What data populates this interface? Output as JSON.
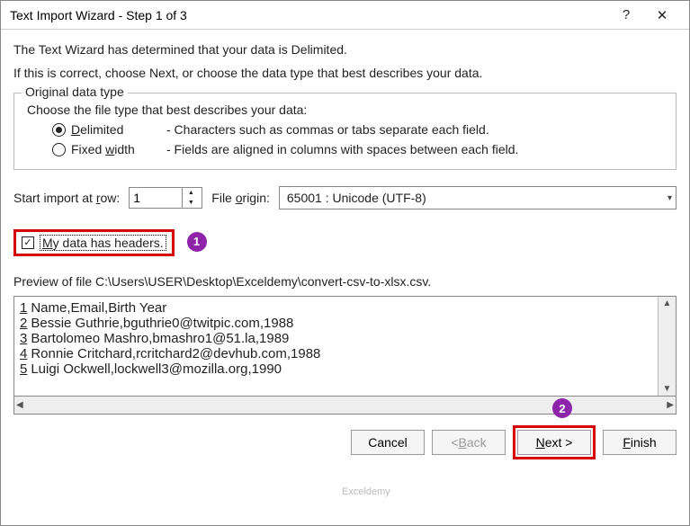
{
  "title": "Text Import Wizard - Step 1 of 3",
  "intro_line1": "The Text Wizard has determined that your data is Delimited.",
  "intro_line2": "If this is correct, choose Next, or choose the data type that best describes your data.",
  "group": {
    "legend": "Original data type",
    "desc": "Choose the file type that best describes your data:",
    "delimited_label": "Delimited",
    "delimited_desc": "- Characters such as commas or tabs separate each field.",
    "fixed_label": "Fixed width",
    "fixed_desc": "- Fields are aligned in columns with spaces between each field."
  },
  "start_row_label": "Start import at row:",
  "start_row_value": "1",
  "file_origin_label": "File origin:",
  "file_origin_value": "65001 : Unicode (UTF-8)",
  "headers_label": "My data has headers.",
  "preview_label": "Preview of file C:\\Users\\USER\\Desktop\\Exceldemy\\convert-csv-to-xlsx.csv.",
  "preview_rows": [
    {
      "n": "1",
      "text": "Name,Email,Birth Year"
    },
    {
      "n": "2",
      "text": "Bessie Guthrie,bguthrie0@twitpic.com,1988"
    },
    {
      "n": "3",
      "text": "Bartolomeo Mashro,bmashro1@51.la,1989"
    },
    {
      "n": "4",
      "text": "Ronnie Critchard,rcritchard2@devhub.com,1988"
    },
    {
      "n": "5",
      "text": "Luigi Ockwell,lockwell3@mozilla.org,1990"
    }
  ],
  "buttons": {
    "cancel": "Cancel",
    "back": "< Back",
    "next": "Next >",
    "finish": "Finish"
  },
  "watermark": "Exceldemy",
  "callouts": {
    "one": "1",
    "two": "2"
  }
}
